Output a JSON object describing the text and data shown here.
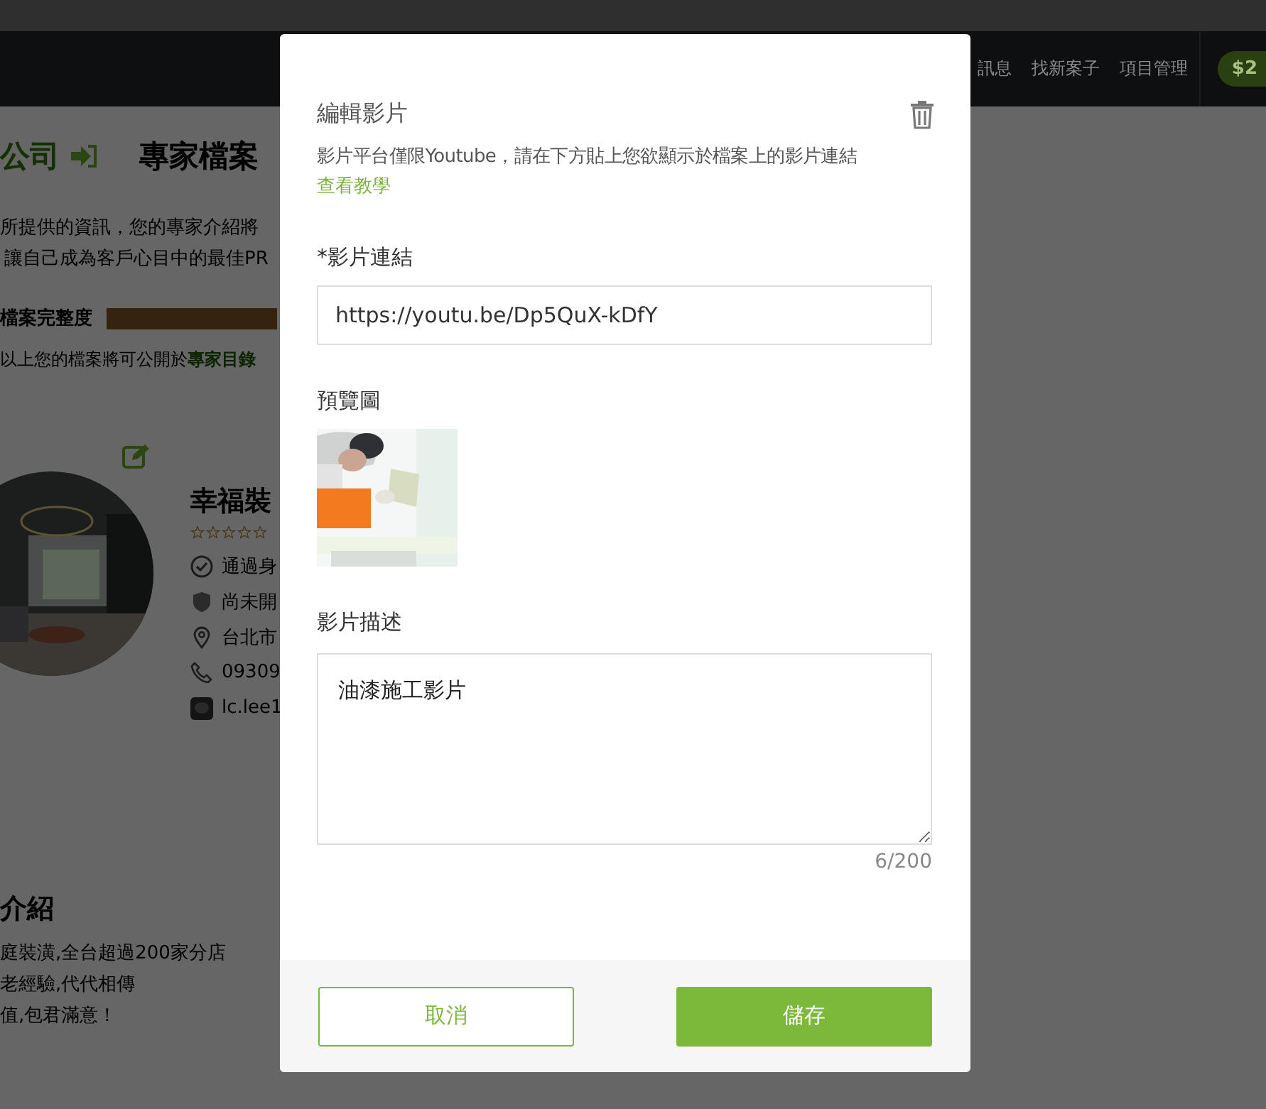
{
  "navbar": {
    "items": [
      "訊息",
      "找新案子",
      "項目管理"
    ],
    "balance": "$2"
  },
  "page": {
    "company": "公司",
    "title": "專家檔案",
    "intro_lines": [
      "所提供的資訊，您的專家介紹將",
      "讓自己成為客戶心目中的最佳PR"
    ],
    "completeness_label": "檔案完整度",
    "publish_note": "以上您的檔案將可公開於",
    "publish_link": "專家目錄",
    "profile": {
      "name": "幸福裝",
      "stars": 0,
      "details": [
        {
          "kind": "verified",
          "text": "通過身"
        },
        {
          "kind": "payment",
          "text": "尚未開"
        },
        {
          "kind": "location",
          "text": "台北市"
        },
        {
          "kind": "phone",
          "text": "09309"
        },
        {
          "kind": "line",
          "text": "lc.lee1"
        }
      ]
    },
    "about_title": "介紹",
    "about_lines": [
      "庭裝潢,全台超過200家分店",
      "老經驗,代代相傳",
      "值,包君滿意！"
    ]
  },
  "modal": {
    "title": "編輯影片",
    "description": "影片平台僅限Youtube，請在下方貼上您欲顯示於檔案上的影片連結",
    "tutorial_link": "查看教學",
    "url_label": "*影片連結",
    "url_value": "https://youtu.be/Dp5QuX-kDfY",
    "preview_label": "預覽圖",
    "desc_label": "影片描述",
    "desc_value": "油漆施工影片",
    "counter": "6/200",
    "buttons": [
      {
        "kind": "secondary",
        "label": "取消"
      },
      {
        "kind": "primary",
        "label": "儲存"
      }
    ]
  }
}
